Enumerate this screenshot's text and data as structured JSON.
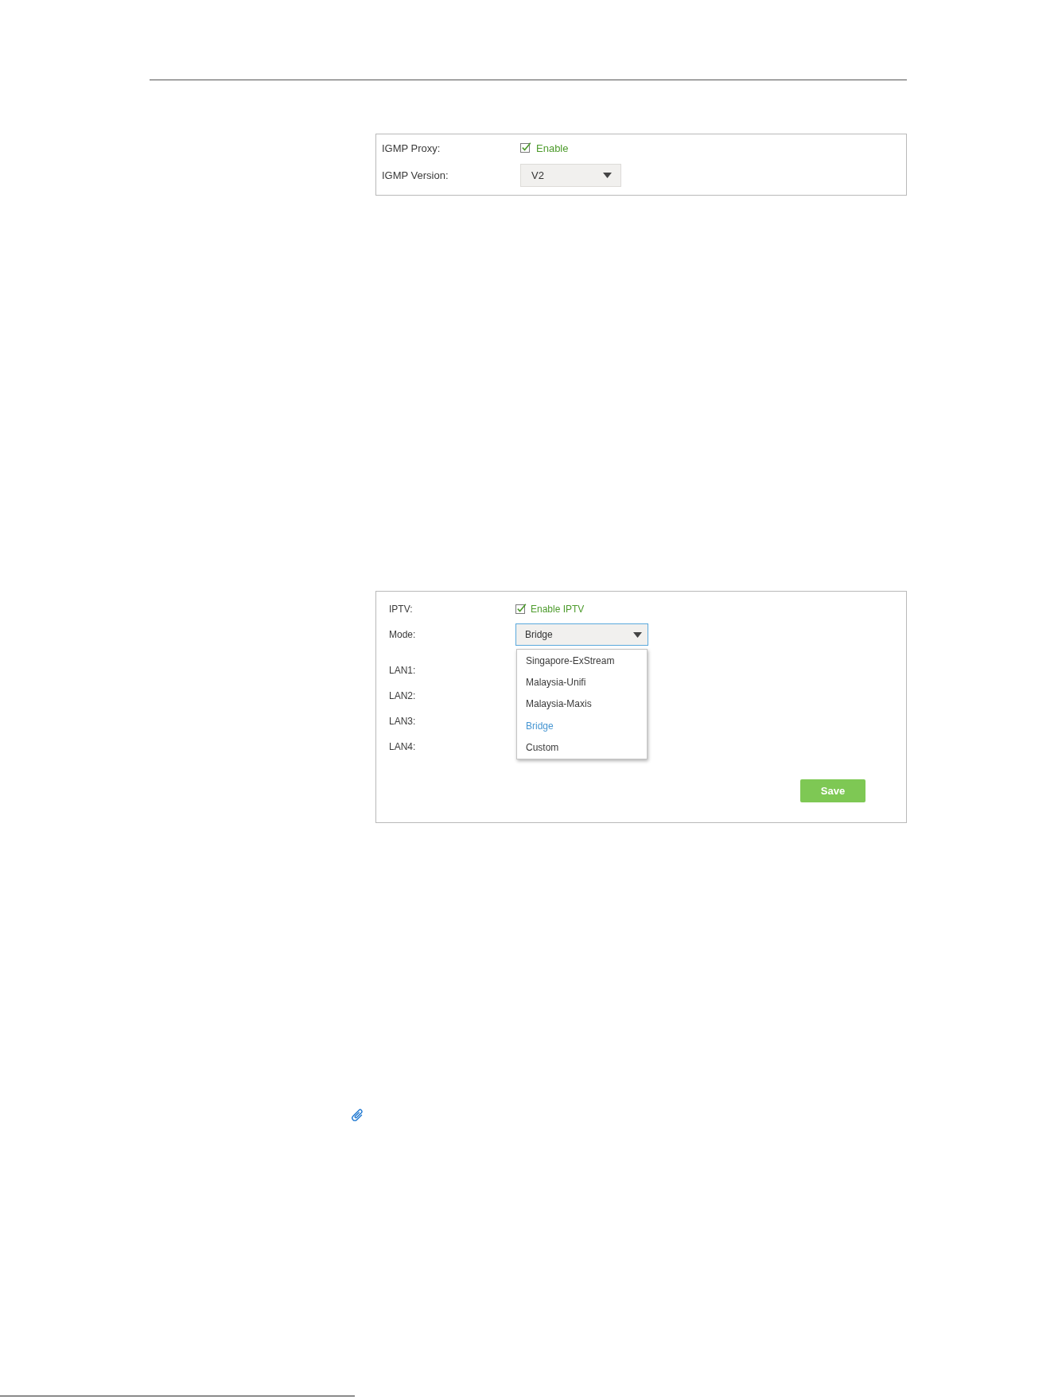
{
  "panels": [
    {
      "rows": [
        {
          "kind": "checkbox",
          "label": "IGMP Proxy:",
          "option": "Enable",
          "checked": true
        },
        {
          "kind": "select",
          "label": "IGMP Version:",
          "value": "V2",
          "expanded": false
        }
      ]
    },
    {
      "rows": [
        {
          "kind": "checkbox",
          "label": "IPTV:",
          "option": "Enable IPTV",
          "checked": true
        },
        {
          "kind": "select",
          "label": "Mode:",
          "value": "Bridge",
          "expanded": true,
          "options": [
            {
              "label": "Singapore-ExStream",
              "selected": false
            },
            {
              "label": "Malaysia-Unifi",
              "selected": false
            },
            {
              "label": "Malaysia-Maxis",
              "selected": false
            },
            {
              "label": "Bridge",
              "selected": true
            },
            {
              "label": "Custom",
              "selected": false
            }
          ]
        },
        {
          "kind": "port",
          "label": "LAN1:"
        },
        {
          "kind": "port",
          "label": "LAN2:"
        },
        {
          "kind": "port",
          "label": "LAN3:"
        },
        {
          "kind": "port",
          "label": "LAN4:"
        }
      ],
      "save_button": "Save"
    }
  ]
}
